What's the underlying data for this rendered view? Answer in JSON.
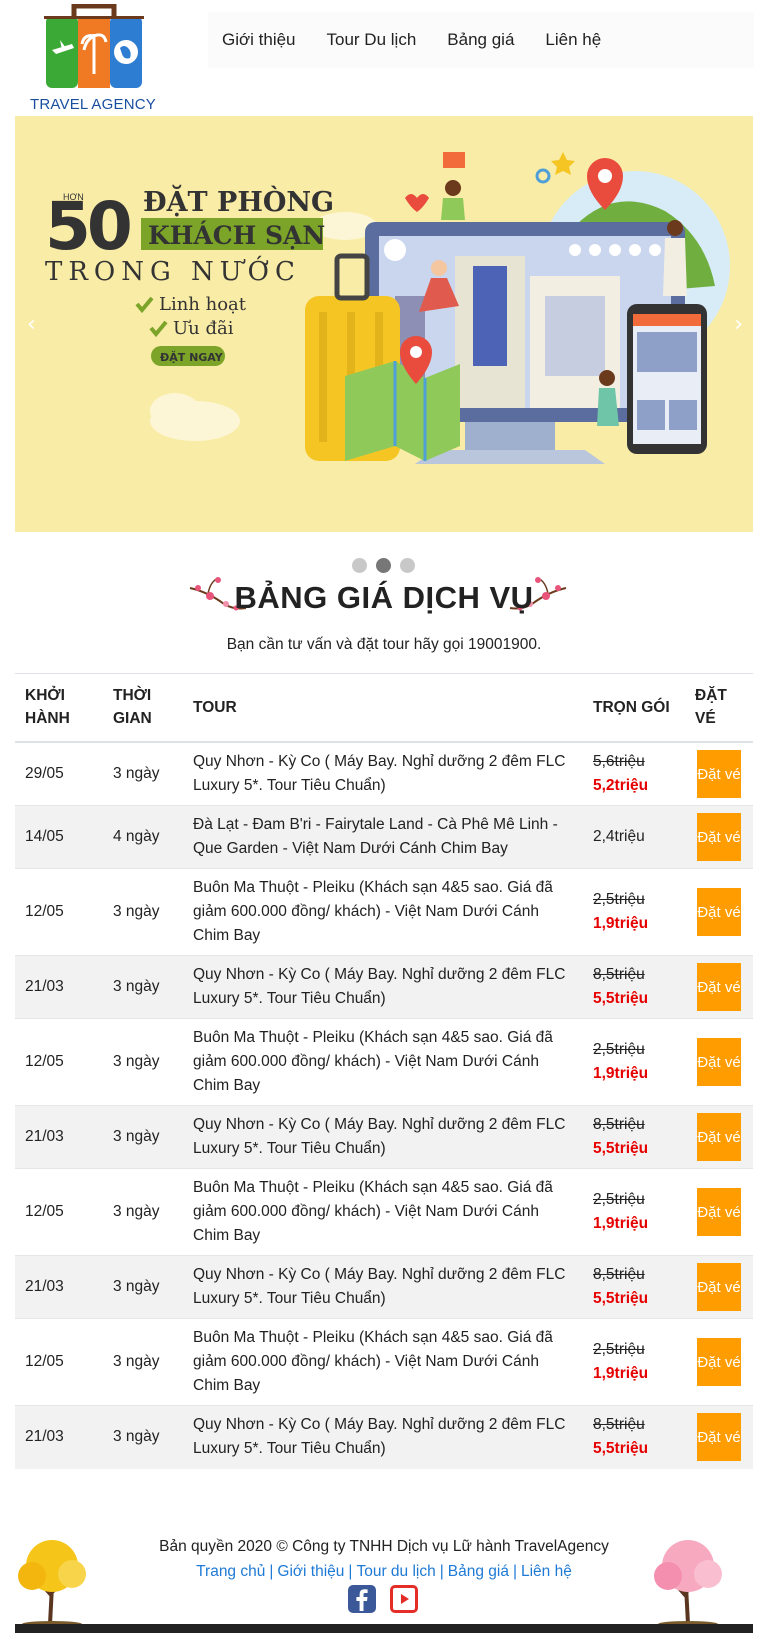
{
  "logo": {
    "text": "TRAVEL AGENCY"
  },
  "nav": {
    "items": [
      "Giới thiệu",
      "Tour Du lịch",
      "Bảng giá",
      "Liên hệ"
    ]
  },
  "banner": {
    "prefix": "HƠN",
    "number": "50",
    "line1": "ĐẶT PHÒNG",
    "line2": "KHÁCH SẠN",
    "line3": "TRONG NƯỚC",
    "feature1": "Linh hoạt",
    "feature2": "Ưu đãi",
    "cta": "ĐẶT NGAY",
    "prev_arrow": "‹",
    "next_arrow": "›",
    "slide_count": 3,
    "active_slide": 2
  },
  "section": {
    "title": "BẢNG GIÁ DỊCH VỤ",
    "subtitle": "Bạn cần tư vấn và đặt tour hãy gọi 19001900."
  },
  "table": {
    "headers": [
      "KHỞI HÀNH",
      "THỜI GIAN",
      "TOUR",
      "TRỌN GÓI",
      "ĐẶT VÉ"
    ],
    "book_label": "Đặt vé",
    "rows": [
      {
        "date": "29/05",
        "duration": "3 ngày",
        "tour": "Quy Nhơn - Kỳ Co ( Máy Bay. Nghỉ dưỡng 2 đêm FLC Luxury 5*. Tour Tiêu Chuẩn)",
        "old_price": "5,6triệu",
        "price": "5,2triệu"
      },
      {
        "date": "14/05",
        "duration": "4 ngày",
        "tour": "Đà Lạt - Đam B'ri - Fairytale Land - Cà Phê Mê Linh - Que Garden - Việt Nam Dưới Cánh Chim Bay",
        "old_price": "",
        "price": "2,4triệu"
      },
      {
        "date": "12/05",
        "duration": "3 ngày",
        "tour": "Buôn Ma Thuột - Pleiku (Khách sạn 4&5 sao. Giá đã giảm 600.000 đồng/ khách) - Việt Nam Dưới Cánh Chim Bay",
        "old_price": "2,5triệu",
        "price": "1,9triệu"
      },
      {
        "date": "21/03",
        "duration": "3 ngày",
        "tour": "Quy Nhơn - Kỳ Co ( Máy Bay. Nghỉ dưỡng 2 đêm FLC Luxury 5*. Tour Tiêu Chuẩn)",
        "old_price": "8,5triệu",
        "price": "5,5triệu"
      },
      {
        "date": "12/05",
        "duration": "3 ngày",
        "tour": "Buôn Ma Thuột - Pleiku (Khách sạn 4&5 sao. Giá đã giảm 600.000 đồng/ khách) - Việt Nam Dưới Cánh Chim Bay",
        "old_price": "2,5triệu",
        "price": "1,9triệu"
      },
      {
        "date": "21/03",
        "duration": "3 ngày",
        "tour": "Quy Nhơn - Kỳ Co ( Máy Bay. Nghỉ dưỡng 2 đêm FLC Luxury 5*. Tour Tiêu Chuẩn)",
        "old_price": "8,5triệu",
        "price": "5,5triệu"
      },
      {
        "date": "12/05",
        "duration": "3 ngày",
        "tour": "Buôn Ma Thuột - Pleiku (Khách sạn 4&5 sao. Giá đã giảm 600.000 đồng/ khách) - Việt Nam Dưới Cánh Chim Bay",
        "old_price": "2,5triệu",
        "price": "1,9triệu"
      },
      {
        "date": "21/03",
        "duration": "3 ngày",
        "tour": "Quy Nhơn - Kỳ Co ( Máy Bay. Nghỉ dưỡng 2 đêm FLC Luxury 5*. Tour Tiêu Chuẩn)",
        "old_price": "8,5triệu",
        "price": "5,5triệu"
      },
      {
        "date": "12/05",
        "duration": "3 ngày",
        "tour": "Buôn Ma Thuột - Pleiku (Khách sạn 4&5 sao. Giá đã giảm 600.000 đồng/ khách) - Việt Nam Dưới Cánh Chim Bay",
        "old_price": "2,5triệu",
        "price": "1,9triệu"
      },
      {
        "date": "21/03",
        "duration": "3 ngày",
        "tour": "Quy Nhơn - Kỳ Co ( Máy Bay. Nghỉ dưỡng 2 đêm FLC Luxury 5*. Tour Tiêu Chuẩn)",
        "old_price": "8,5triệu",
        "price": "5,5triệu"
      }
    ]
  },
  "footer": {
    "copyright": "Bản quyền 2020 © Công ty TNHH Dịch vụ Lữ hành TravelAgency",
    "links": [
      "Trang chủ",
      "Giới thiệu",
      "Tour du lịch",
      "Bảng giá",
      "Liên hệ"
    ],
    "separator": "|",
    "social_icons": [
      "facebook-icon",
      "youtube-icon"
    ]
  },
  "colors": {
    "accent": "#ff9d00",
    "sale_price": "#e60000",
    "link": "#1e7ad6",
    "banner_bg": "#f9eca6",
    "banner_green": "#7ba428"
  }
}
